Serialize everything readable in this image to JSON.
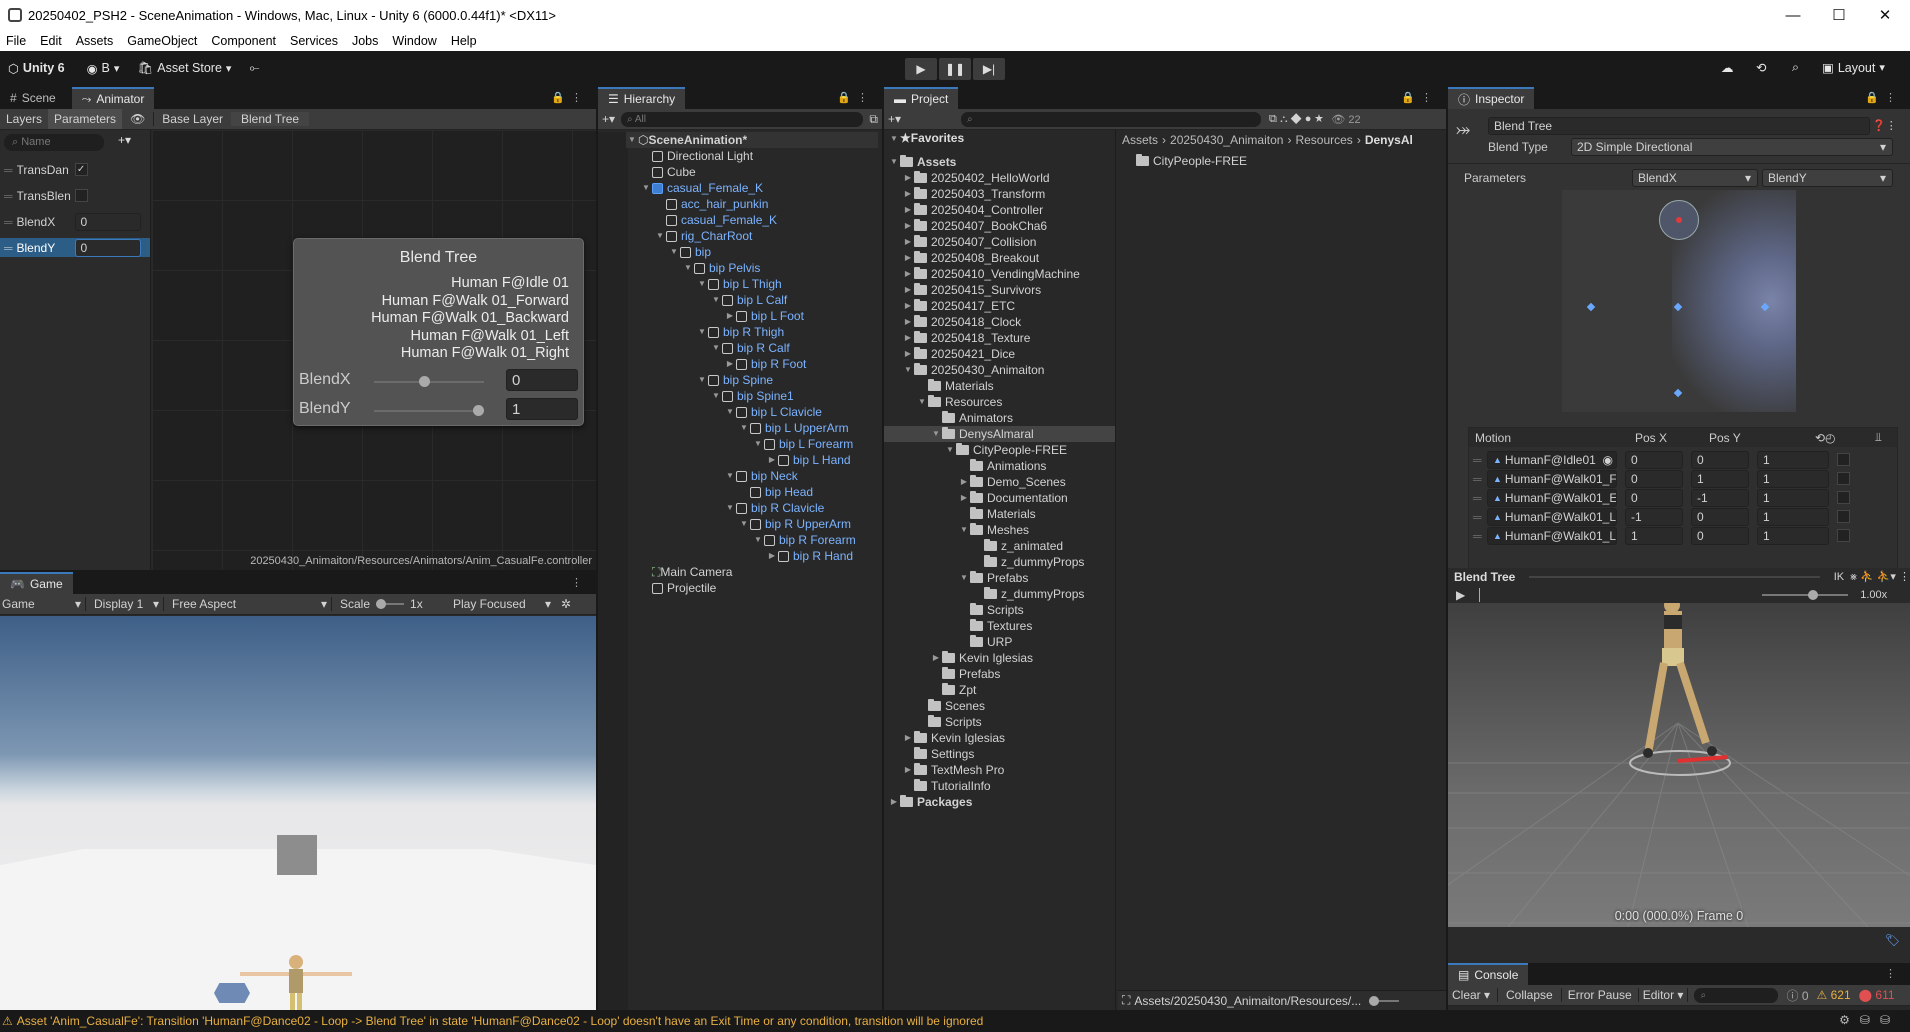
{
  "window": {
    "title": "20250402_PSH2 - SceneAnimation - Windows, Mac, Linux - Unity 6 (6000.0.44f1)* <DX11>",
    "controls": [
      "—",
      "☐",
      "✕"
    ]
  },
  "menu": [
    "File",
    "Edit",
    "Assets",
    "GameObject",
    "Component",
    "Services",
    "Jobs",
    "Window",
    "Help"
  ],
  "toolbar": {
    "unity_label": "Unity 6",
    "account": "B",
    "asset_store": "Asset Store",
    "layout": "Layout"
  },
  "animator": {
    "tabs": [
      "Scene",
      "Animator"
    ],
    "subtabs": [
      "Layers",
      "Parameters"
    ],
    "breadcrumb": [
      "Base Layer",
      "Blend Tree"
    ],
    "search_placeholder": "Name",
    "params": [
      {
        "name": "TransDan",
        "value": "✓"
      },
      {
        "name": "TransBlen",
        "value": ""
      },
      {
        "name": "BlendX",
        "value": "0"
      },
      {
        "name": "BlendY",
        "value": "0"
      }
    ],
    "node": {
      "title": "Blend Tree",
      "motions": [
        "Human F@Idle 01",
        "Human F@Walk 01_Forward",
        "Human F@Walk 01_Backward",
        "Human F@Walk 01_Left",
        "Human F@Walk 01_Right"
      ],
      "blendx_label": "BlendX",
      "blendx": 0,
      "blendy_label": "BlendY",
      "blendy": 1
    },
    "path": "20250430_Animaiton/Resources/Animators/Anim_CasualFe.controller"
  },
  "game": {
    "tab": "Game",
    "mode": "Game",
    "display": "Display 1",
    "aspect": "Free Aspect",
    "scale_label": "Scale",
    "scale": "1x",
    "play_focused": "Play Focused"
  },
  "hierarchy": {
    "tab": "Hierarchy",
    "search": "All",
    "items": [
      {
        "label": "SceneAnimation*",
        "indent": 0,
        "arrow": "▼",
        "icon": "unity",
        "bold": true
      },
      {
        "label": "Directional Light",
        "indent": 1,
        "arrow": "",
        "icon": "cube"
      },
      {
        "label": "Cube",
        "indent": 1,
        "arrow": "",
        "icon": "cube"
      },
      {
        "label": "casual_Female_K",
        "indent": 1,
        "arrow": "▼",
        "icon": "prefab",
        "blue": true
      },
      {
        "label": "acc_hair_punkin",
        "indent": 2,
        "arrow": "",
        "icon": "cube",
        "blue": true
      },
      {
        "label": "casual_Female_K",
        "indent": 2,
        "arrow": "",
        "icon": "cube",
        "blue": true
      },
      {
        "label": "rig_CharRoot",
        "indent": 2,
        "arrow": "▼",
        "icon": "cube",
        "blue": true
      },
      {
        "label": "bip",
        "indent": 3,
        "arrow": "▼",
        "icon": "cube",
        "blue": true
      },
      {
        "label": "bip Pelvis",
        "indent": 4,
        "arrow": "▼",
        "icon": "cube",
        "blue": true
      },
      {
        "label": "bip L Thigh",
        "indent": 5,
        "arrow": "▼",
        "icon": "cube",
        "blue": true
      },
      {
        "label": "bip L Calf",
        "indent": 6,
        "arrow": "▼",
        "icon": "cube",
        "blue": true
      },
      {
        "label": "bip L Foot",
        "indent": 7,
        "arrow": "▶",
        "icon": "cube",
        "blue": true
      },
      {
        "label": "bip R Thigh",
        "indent": 5,
        "arrow": "▼",
        "icon": "cube",
        "blue": true
      },
      {
        "label": "bip R Calf",
        "indent": 6,
        "arrow": "▼",
        "icon": "cube",
        "blue": true
      },
      {
        "label": "bip R Foot",
        "indent": 7,
        "arrow": "▶",
        "icon": "cube",
        "blue": true
      },
      {
        "label": "bip Spine",
        "indent": 5,
        "arrow": "▼",
        "icon": "cube",
        "blue": true
      },
      {
        "label": "bip Spine1",
        "indent": 6,
        "arrow": "▼",
        "icon": "cube",
        "blue": true
      },
      {
        "label": "bip L Clavicle",
        "indent": 7,
        "arrow": "▼",
        "icon": "cube",
        "blue": true
      },
      {
        "label": "bip L UpperArm",
        "indent": 8,
        "arrow": "▼",
        "icon": "cube",
        "blue": true
      },
      {
        "label": "bip L Forearm",
        "indent": 9,
        "arrow": "▼",
        "icon": "cube",
        "blue": true
      },
      {
        "label": "bip L Hand",
        "indent": 10,
        "arrow": "▶",
        "icon": "cube",
        "blue": true
      },
      {
        "label": "bip Neck",
        "indent": 7,
        "arrow": "▼",
        "icon": "cube",
        "blue": true
      },
      {
        "label": "bip Head",
        "indent": 8,
        "arrow": "",
        "icon": "cube",
        "blue": true
      },
      {
        "label": "bip R Clavicle",
        "indent": 7,
        "arrow": "▼",
        "icon": "cube",
        "blue": true
      },
      {
        "label": "bip R UpperArm",
        "indent": 8,
        "arrow": "▼",
        "icon": "cube",
        "blue": true
      },
      {
        "label": "bip R Forearm",
        "indent": 9,
        "arrow": "▼",
        "icon": "cube",
        "blue": true
      },
      {
        "label": "bip R Hand",
        "indent": 10,
        "arrow": "▶",
        "icon": "cube",
        "blue": true
      },
      {
        "label": "Main Camera",
        "indent": 1,
        "arrow": "",
        "icon": "camera"
      },
      {
        "label": "Projectile",
        "indent": 1,
        "arrow": "",
        "icon": "cube"
      }
    ]
  },
  "project": {
    "tab": "Project",
    "favorites": "Favorites",
    "count": "22",
    "breadcrumb": [
      "Assets",
      "20250430_Animaiton",
      "Resources",
      "DenysAl"
    ],
    "content": [
      "CityPeople-FREE"
    ],
    "footer_path": "Assets/20250430_Animaiton/Resources/...",
    "tree": [
      {
        "label": "Assets",
        "indent": 0,
        "arrow": "▼",
        "bold": true
      },
      {
        "label": "20250402_HelloWorld",
        "indent": 1,
        "arrow": "▶"
      },
      {
        "label": "20250403_Transform",
        "indent": 1,
        "arrow": "▶"
      },
      {
        "label": "20250404_Controller",
        "indent": 1,
        "arrow": "▶"
      },
      {
        "label": "20250407_BookCha6",
        "indent": 1,
        "arrow": "▶"
      },
      {
        "label": "20250407_Collision",
        "indent": 1,
        "arrow": "▶"
      },
      {
        "label": "20250408_Breakout",
        "indent": 1,
        "arrow": "▶"
      },
      {
        "label": "20250410_VendingMachine",
        "indent": 1,
        "arrow": "▶"
      },
      {
        "label": "20250415_Survivors",
        "indent": 1,
        "arrow": "▶"
      },
      {
        "label": "20250417_ETC",
        "indent": 1,
        "arrow": "▶"
      },
      {
        "label": "20250418_Clock",
        "indent": 1,
        "arrow": "▶"
      },
      {
        "label": "20250418_Texture",
        "indent": 1,
        "arrow": "▶"
      },
      {
        "label": "20250421_Dice",
        "indent": 1,
        "arrow": "▶"
      },
      {
        "label": "20250430_Animaiton",
        "indent": 1,
        "arrow": "▼"
      },
      {
        "label": "Materials",
        "indent": 2,
        "arrow": ""
      },
      {
        "label": "Resources",
        "indent": 2,
        "arrow": "▼"
      },
      {
        "label": "Animators",
        "indent": 3,
        "arrow": ""
      },
      {
        "label": "DenysAlmaral",
        "indent": 3,
        "arrow": "▼",
        "selected": true
      },
      {
        "label": "CityPeople-FREE",
        "indent": 4,
        "arrow": "▼"
      },
      {
        "label": "Animations",
        "indent": 5,
        "arrow": ""
      },
      {
        "label": "Demo_Scenes",
        "indent": 5,
        "arrow": "▶"
      },
      {
        "label": "Documentation",
        "indent": 5,
        "arrow": "▶"
      },
      {
        "label": "Materials",
        "indent": 5,
        "arrow": ""
      },
      {
        "label": "Meshes",
        "indent": 5,
        "arrow": "▼"
      },
      {
        "label": "z_animated",
        "indent": 6,
        "arrow": ""
      },
      {
        "label": "z_dummyProps",
        "indent": 6,
        "arrow": ""
      },
      {
        "label": "Prefabs",
        "indent": 5,
        "arrow": "▼"
      },
      {
        "label": "z_dummyProps",
        "indent": 6,
        "arrow": ""
      },
      {
        "label": "Scripts",
        "indent": 5,
        "arrow": ""
      },
      {
        "label": "Textures",
        "indent": 5,
        "arrow": ""
      },
      {
        "label": "URP",
        "indent": 5,
        "arrow": ""
      },
      {
        "label": "Kevin Iglesias",
        "indent": 3,
        "arrow": "▶"
      },
      {
        "label": "Prefabs",
        "indent": 3,
        "arrow": ""
      },
      {
        "label": "Zpt",
        "indent": 3,
        "arrow": ""
      },
      {
        "label": "Scenes",
        "indent": 2,
        "arrow": ""
      },
      {
        "label": "Scripts",
        "indent": 2,
        "arrow": ""
      },
      {
        "label": "Kevin Iglesias",
        "indent": 1,
        "arrow": "▶"
      },
      {
        "label": "Settings",
        "indent": 1,
        "arrow": ""
      },
      {
        "label": "TextMesh Pro",
        "indent": 1,
        "arrow": "▶"
      },
      {
        "label": "TutorialInfo",
        "indent": 1,
        "arrow": ""
      },
      {
        "label": "Packages",
        "indent": 0,
        "arrow": "▶",
        "bold": true
      }
    ]
  },
  "inspector": {
    "tab": "Inspector",
    "name": "Blend Tree",
    "blend_type_label": "Blend Type",
    "blend_type": "2D Simple Directional",
    "parameters_label": "Parameters",
    "param_x": "BlendX",
    "param_y": "BlendY",
    "table_headers": [
      "Motion",
      "Pos X",
      "Pos Y"
    ],
    "motions": [
      {
        "name": "HumanF@Idle01",
        "x": "0",
        "y": "0",
        "speed": "1"
      },
      {
        "name": "HumanF@Walk01_F",
        "x": "0",
        "y": "1",
        "speed": "1"
      },
      {
        "name": "HumanF@Walk01_E",
        "x": "0",
        "y": "-1",
        "speed": "1"
      },
      {
        "name": "HumanF@Walk01_L",
        "x": "-1",
        "y": "0",
        "speed": "1"
      },
      {
        "name": "HumanF@Walk01_L",
        "x": "1",
        "y": "0",
        "speed": "1"
      }
    ],
    "preview_title": "Blend Tree",
    "preview_ik": "IK",
    "preview_speed": "1.00x",
    "frame_text": "0:00 (000.0%) Frame 0"
  },
  "console": {
    "tab": "Console",
    "clear": "Clear",
    "collapse": "Collapse",
    "error_pause": "Error Pause",
    "editor": "Editor",
    "info_count": "0",
    "warn_count": "621",
    "error_count": "611"
  },
  "status": {
    "message": "Asset 'Anim_CasualFe': Transition 'HumanF@Dance02 - Loop -> Blend Tree' in state 'HumanF@Dance02 - Loop' doesn't have an Exit Time or any condition, transition will be ignored"
  },
  "colors": {
    "accent": "#3a79bb",
    "prefab_blue": "#7cb3ff",
    "warning": "#e8b043",
    "error": "#e04040"
  }
}
